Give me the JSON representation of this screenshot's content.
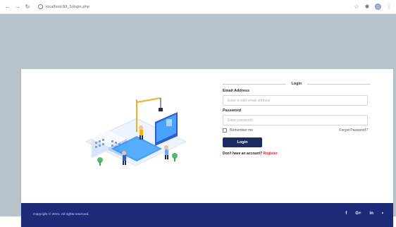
{
  "browser": {
    "url": "localhost:8/t_5/login.php",
    "back_icon": "back-arrow-icon",
    "forward_icon": "forward-arrow-icon",
    "reload_icon": "reload-icon"
  },
  "login": {
    "heading": "Login",
    "email": {
      "label": "Email Address",
      "placeholder": "Enter a valid email address"
    },
    "password": {
      "label": "Password",
      "placeholder": "Enter password"
    },
    "remember_label": "Remember me",
    "forgot_link": "Forgot Password?",
    "submit_label": "Login",
    "no_account_text": "Don't have an account?",
    "register_link": "Register"
  },
  "footer": {
    "copyright": "Copyright © 2021. All rights reserved.",
    "social": {
      "facebook": "f",
      "google": "G+",
      "linkedin": "in",
      "twitter": "•"
    }
  },
  "colors": {
    "accent": "#1d2a64",
    "register_link": "#d21f2b",
    "footer_bg": "#1d2a78",
    "page_bg": "#b8c3cb"
  }
}
